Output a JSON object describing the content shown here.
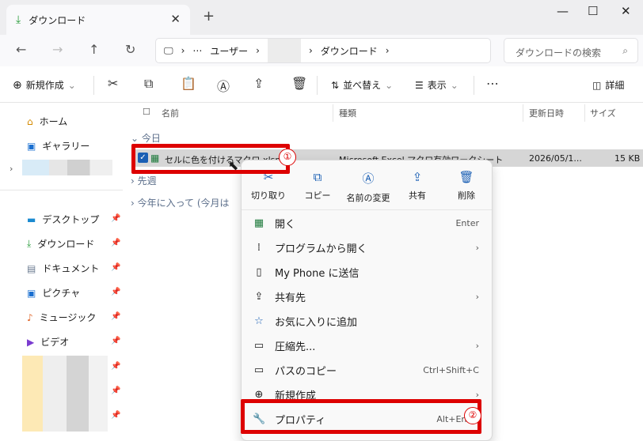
{
  "tab": {
    "title": "ダウンロード"
  },
  "address": {
    "crumb1": "ユーザー",
    "crumb2": "ダウンロード",
    "search": "ダウンロードの検索"
  },
  "toolbar": {
    "new": "新規作成",
    "sort": "並べ替え",
    "view": "表示",
    "details": "詳細"
  },
  "sidebar": {
    "home": "ホーム",
    "gallery": "ギャラリー",
    "desktop": "デスクトップ",
    "downloads": "ダウンロード",
    "documents": "ドキュメント",
    "pictures": "ピクチャ",
    "music": "ミュージック",
    "videos": "ビデオ"
  },
  "columns": {
    "name": "名前",
    "type": "種類",
    "modified": "更新日時",
    "size": "サイズ"
  },
  "groups": {
    "today": "今日",
    "lastweek": "先週",
    "thisyear": "今年に入って (今月は"
  },
  "file": {
    "name": "セルに色を付けるマクロ.xlsm",
    "type": "Microsoft Excel マクロ有効ワークシート",
    "date": "2026/05/1...",
    "size": "15 KB"
  },
  "context": {
    "cut": "切り取り",
    "copy": "コピー",
    "rename": "名前の変更",
    "share": "共有",
    "delete": "削除",
    "open": "開く",
    "open_sc": "Enter",
    "openwith": "プログラムから開く",
    "phone": "My Phone に送信",
    "shareto": "共有先",
    "fav": "お気に入りに追加",
    "compress": "圧縮先...",
    "copypath": "パスのコピー",
    "copypath_sc": "Ctrl+Shift+C",
    "newitem": "新規作成",
    "props": "プロパティ",
    "props_sc": "Alt+Enter"
  },
  "annotations": {
    "one": "①",
    "two": "②"
  }
}
